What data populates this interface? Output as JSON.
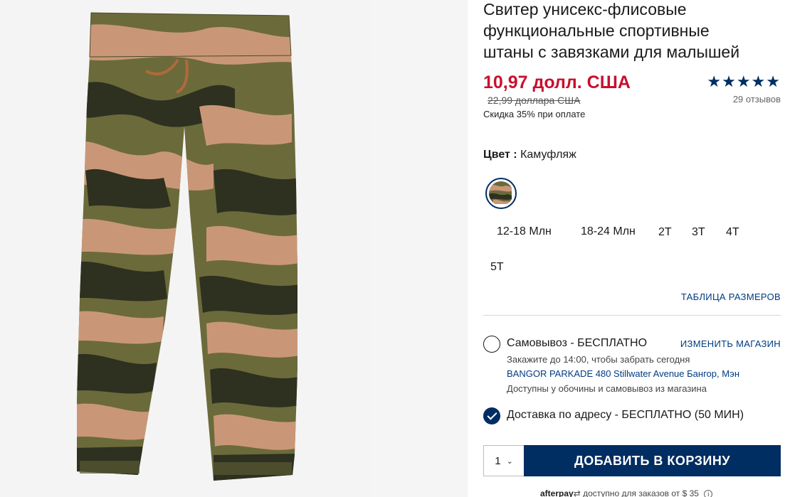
{
  "product": {
    "title_line1": "Свитер унисекс-флисовые",
    "title_line2": "функциональные спортивные",
    "title_line3": "штаны с завязками для малышей",
    "price_sale": "10,97 долл. США",
    "price_original": "22,99 доллара США",
    "discount_note": "Скидка 35% при оплате",
    "rating_value": 4.5,
    "rating_stars": "★★★★★",
    "review_count": "29 отзывов",
    "image_icon": "camo-jogger-pants-image"
  },
  "color": {
    "label": "Цвет :",
    "value": "Камуфляж",
    "swatch_icon": "camo-swatch"
  },
  "sizes": [
    "12-18 Млн",
    "18-24 Млн",
    "2T",
    "3T",
    "4T",
    "5T"
  ],
  "size_chart_link": "ТАБЛИЦА РАЗМЕРОВ",
  "fulfillment": {
    "pickup_label": "Самовывоз - БЕСПЛАТНО",
    "change_store": "ИЗМЕНИТЬ МАГАЗИН",
    "pickup_note": "Закажите до 14:00, чтобы забрать сегодня",
    "store_address": "BANGOR PARKADE 480 Stillwater Avenue  Бангор, Мэн",
    "pickup_availability": "Доступны у обочины и самовывоз из магазина",
    "shipping_label": "Доставка по адресу - БЕСПЛАТНО (50 МИН)",
    "shipping_selected": true
  },
  "cart": {
    "quantity": "1",
    "add_button": "ДОБАВИТЬ В КОРЗИНУ"
  },
  "afterpay": {
    "brand": "afterpay",
    "note": "доступно для заказов от $ 35"
  },
  "colors": {
    "brand_navy": "#002d62",
    "sale_red": "#c8102e",
    "link_blue": "#003b80"
  }
}
